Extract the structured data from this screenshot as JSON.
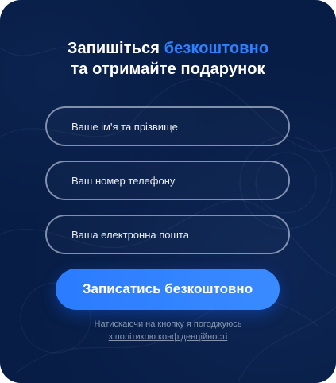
{
  "form": {
    "title_part1": "Запишіться ",
    "title_accent": "безкоштовно",
    "title_part2": "та отримайте подарунок",
    "name_placeholder": "Ваше ім'я та прізвище",
    "phone_placeholder": "Ваш номер телефону",
    "email_placeholder": "Ваша електронна пошта",
    "submit_label": "Записатись безкоштовно",
    "consent_text": "Натискаючи на кнопку я погоджуюсь",
    "policy_link_text": "з політикою конфіденційності"
  },
  "colors": {
    "background": "#071d45",
    "accent": "#2f80ff",
    "button": "#2b7bff",
    "input_border": "#becbe1",
    "muted_text": "#b4c0d4"
  }
}
